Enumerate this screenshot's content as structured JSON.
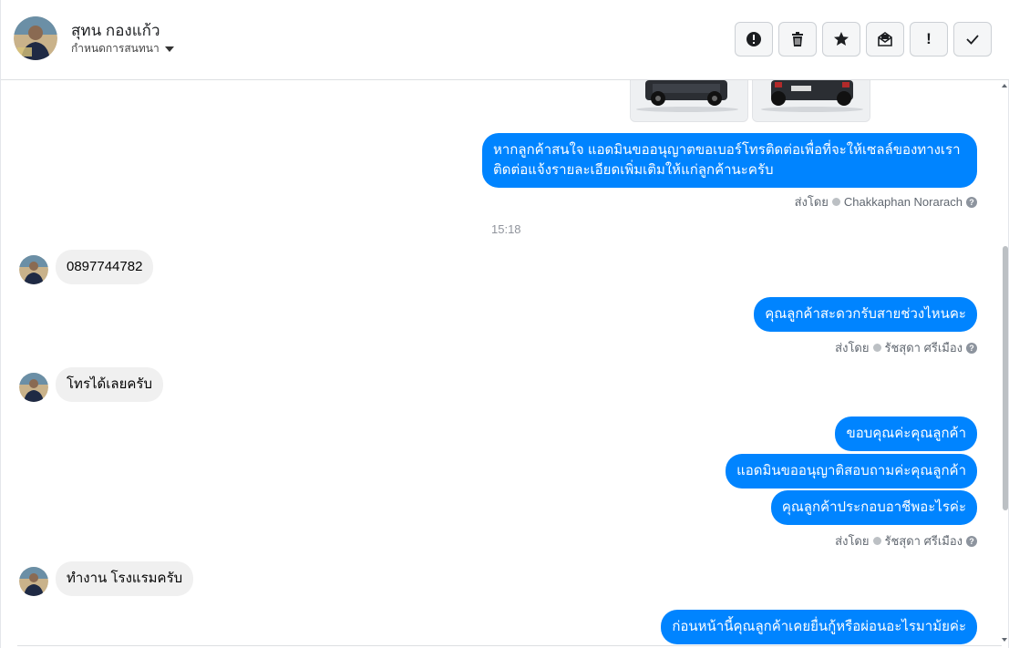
{
  "header": {
    "contact_name": "สุทน กองแก้ว",
    "assign_label": "กำหนดการสนทนา"
  },
  "toolbar": {
    "buttons": [
      "spam-icon",
      "trash-icon",
      "star-icon",
      "mark-unread-icon",
      "follow-up-icon",
      "done-icon"
    ],
    "follow_up_glyph": "!"
  },
  "messages": {
    "m1_out": "หากลูกค้าสนใจ แอดมินขออนุญาตขอเบอร์โทรติดต่อเพื่อที่จะให้เซลล์ของทางเรา ติดต่อแจ้งรายละเอียดเพิ่มเติมให้แก่ลูกค้านะครับ",
    "m1_sent_prefix": "ส่งโดย",
    "m1_sender": "Chakkaphan Norarach",
    "timestamp": "15:18",
    "m2_in": "0897744782",
    "m3_out": "คุณลูกค้าสะดวกรับสายช่วงไหนคะ",
    "m3_sent_prefix": "ส่งโดย",
    "m3_sender": "รัชสุดา ศรีเมือง",
    "m4_in": "โทรได้เลยครับ",
    "m5_out": "ขอบคุณค่ะคุณลูกค้า",
    "m6_out": "แอดมินขออนุญาติสอบถามค่ะคุณลูกค้า",
    "m7_out": "คุณลูกค้าประกอบอาชีพอะไรค่ะ",
    "m7_sent_prefix": "ส่งโดย",
    "m7_sender": "รัชสุดา ศรีเมือง",
    "m8_in": "ทำงาน โรงแรมครับ",
    "m9_out": "ก่อนหน้านี้คุณลูกค้าเคยยื่นกู้หรือผ่อนอะไรมาม้ยค่ะ"
  },
  "help_glyph": "?"
}
